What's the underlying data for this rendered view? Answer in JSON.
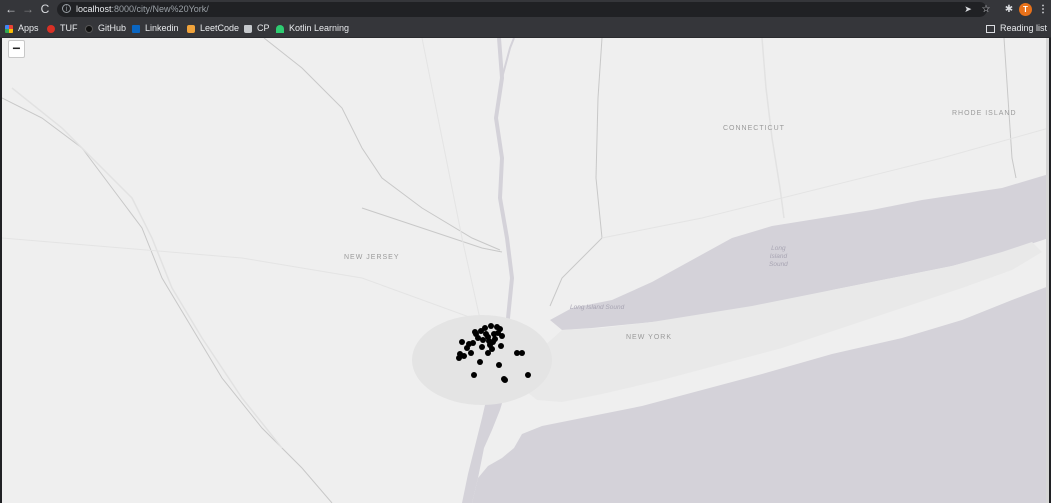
{
  "browser": {
    "back_icon": "←",
    "forward_icon": "→",
    "reload_icon": "C",
    "url_host": "localhost",
    "url_rest": ":8000/city/New%20York/",
    "icons": [
      "arrow-left-icon",
      "arrow-right-icon",
      "reload-icon",
      "info-icon",
      "send-icon",
      "star-icon",
      "extensions-icon",
      "kebab-menu-icon"
    ],
    "avatar_letter": "T",
    "avatar_color": "#e8711a"
  },
  "bookmarks": {
    "items": [
      {
        "label": "Apps",
        "icon": "apps-grid-icon"
      },
      {
        "label": "TUF",
        "icon": "tuf-icon"
      },
      {
        "label": "GitHub",
        "icon": "github-icon"
      },
      {
        "label": "Linkedin",
        "icon": "linkedin-icon"
      },
      {
        "label": "LeetCode",
        "icon": "leetcode-icon"
      },
      {
        "label": "CP",
        "icon": "folder-icon"
      },
      {
        "label": "Kotlin Learning",
        "icon": "kotlin-icon"
      }
    ],
    "reading_list": "Reading list"
  },
  "map": {
    "zoom_out_label": "−",
    "labels": {
      "connecticut": "CONNECTICUT",
      "rhode_island": "RHODE ISLAND",
      "new_jersey": "NEW JERSEY",
      "new_york": "NEW YORK"
    },
    "water_labels": {
      "long_island_sound_1": "Long\nIsland\nSound",
      "long_island_sound_2": "Long Island Sound"
    },
    "colors": {
      "land": "#efefef",
      "water": "#d4d2d9",
      "border": "#c8c8c8",
      "marker": "#000000"
    },
    "marker_count": 38
  }
}
